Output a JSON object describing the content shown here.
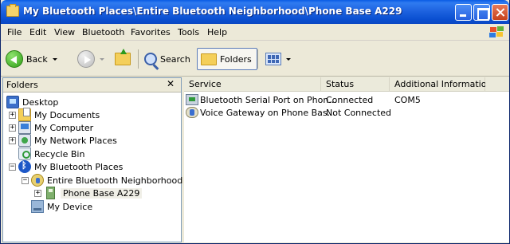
{
  "window": {
    "title": "My Bluetooth Places\\Entire Bluetooth Neighborhood\\Phone Base  A229"
  },
  "menu": [
    "File",
    "Edit",
    "View",
    "Bluetooth",
    "Favorites",
    "Tools",
    "Help"
  ],
  "toolbar": {
    "back_label": "Back",
    "search_label": "Search",
    "folders_label": "Folders"
  },
  "folders_pane": {
    "title": "Folders",
    "close_glyph": "✕",
    "items": [
      {
        "label": "Desktop",
        "icon": "desktop-icon",
        "expander": ""
      },
      {
        "label": "My Documents",
        "icon": "my-documents-icon",
        "expander": "+"
      },
      {
        "label": "My Computer",
        "icon": "my-computer-icon",
        "expander": "+"
      },
      {
        "label": "My Network Places",
        "icon": "network-places-icon",
        "expander": "+"
      },
      {
        "label": "Recycle Bin",
        "icon": "recycle-bin-icon",
        "expander": ""
      },
      {
        "label": "My Bluetooth Places",
        "icon": "bluetooth-icon",
        "expander": "−"
      },
      {
        "label": "Entire Bluetooth Neighborhood",
        "icon": "neighborhood-icon",
        "expander": "−"
      },
      {
        "label": "Phone Base  A229",
        "icon": "phone-icon",
        "expander": "+"
      },
      {
        "label": "My Device",
        "icon": "my-device-icon",
        "expander": ""
      }
    ]
  },
  "list": {
    "columns": [
      "Service",
      "Status",
      "Additional Information"
    ],
    "rows": [
      {
        "service": "Bluetooth Serial Port on Phon...",
        "status": "Connected",
        "info": "COM5",
        "icon": "serial-port-icon"
      },
      {
        "service": "Voice Gateway on Phone Bas...",
        "status": "Not Connected",
        "info": "",
        "icon": "voice-gateway-icon"
      }
    ]
  },
  "colors": {
    "titlebar": "#0a4fd1",
    "chrome": "#ece9d8",
    "close_button": "#c6411c"
  }
}
